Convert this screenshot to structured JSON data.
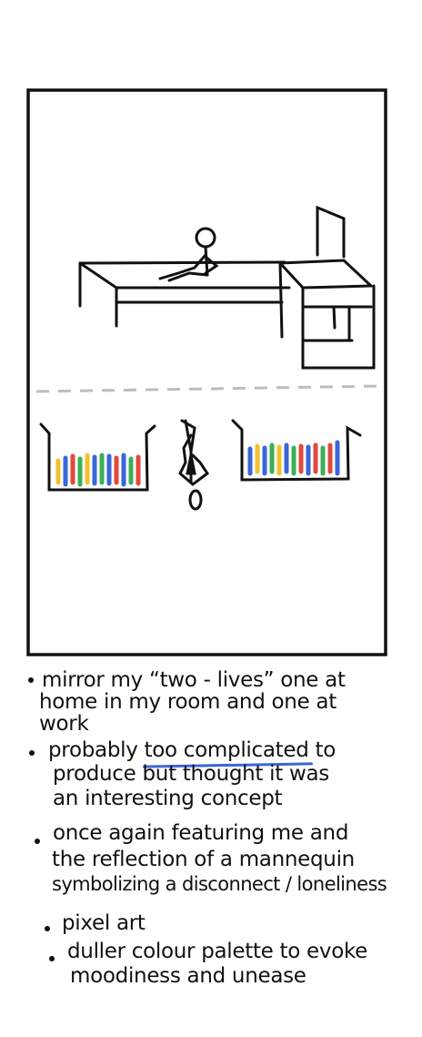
{
  "notes": {
    "bullet1": {
      "line1": "mirror my “two - lives” one at",
      "line2": "home in my room and one at",
      "line3": "work"
    },
    "bullet2": {
      "line1_pre": "probably ",
      "line1_highlight": "too complicated",
      "line1_post": " to",
      "line2": "produce but thought it was",
      "line3": "an interesting concept"
    },
    "bullet3": {
      "line1": "once again featuring me and",
      "line2": "the reflection of a mannequin",
      "line3": "symbolizing a disconnect / loneliness"
    },
    "bullet4": {
      "line1": "pixel art"
    },
    "bullet5": {
      "line1": "duller colour palette to evoke",
      "line2": "moodiness and unease"
    }
  },
  "colors": {
    "ink": "#111111",
    "mirror_line": "#bdbdbd",
    "underline": "#3a66d8",
    "clothes": [
      "#f2c12e",
      "#3a66d8",
      "#e04a3c",
      "#3cae5a",
      "#3a66d8",
      "#f2c12e"
    ]
  }
}
